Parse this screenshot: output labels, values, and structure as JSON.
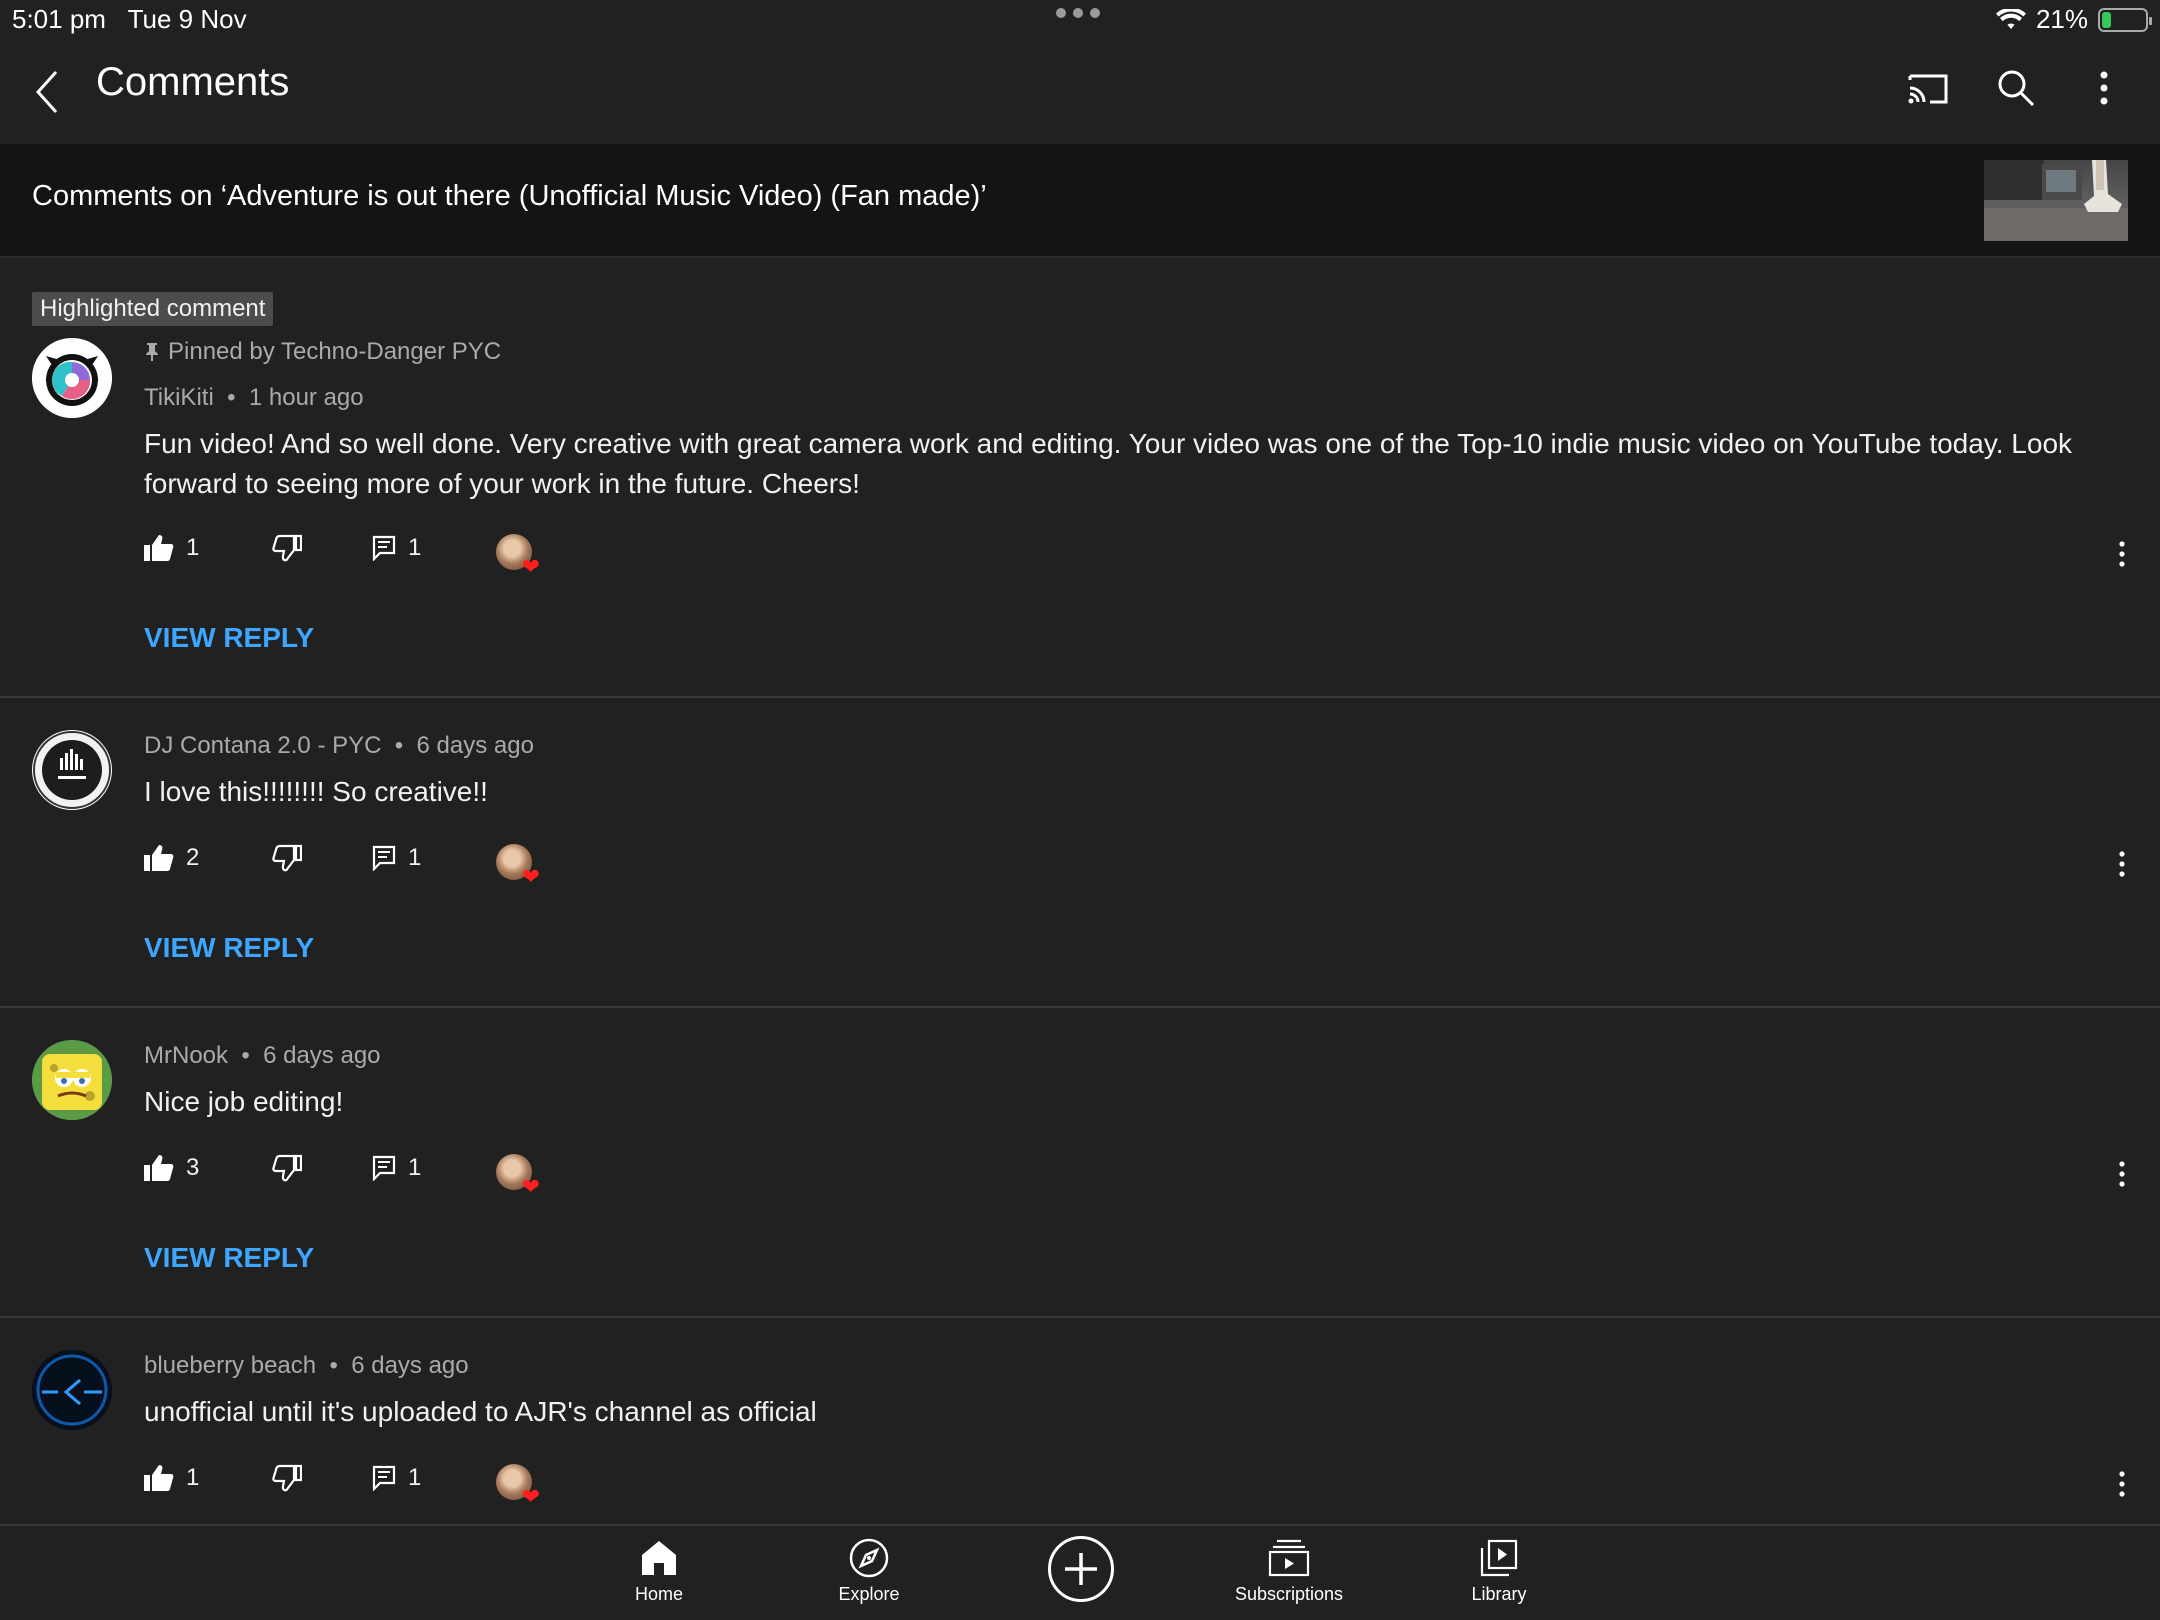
{
  "status_bar": {
    "time": "5:01 pm",
    "date": "Tue 9 Nov",
    "battery": "21%",
    "battery_level": 0.21
  },
  "app_bar": {
    "title": "Comments",
    "icons": [
      "back-arrow-icon",
      "cast-icon",
      "search-icon",
      "more-vert-icon"
    ]
  },
  "video": {
    "title": "Comments on ‘Adventure is out there (Unofficial Music Video) (Fan made)’"
  },
  "comments": [
    {
      "badge": "Highlighted comment",
      "pinned": "Pinned by Techno-Danger PYC",
      "author": "TikiKiti",
      "time": "1 hour ago",
      "text": "Fun video! And so well done. Very creative with great camera work and editing. Your video was one of the Top-10 indie music video on YouTube today.  Look forward to seeing more of your work in the future. Cheers!",
      "likes": "1",
      "replies": "1",
      "view_reply": "VIEW REPLY"
    },
    {
      "author": "DJ Contana 2.0 - PYC",
      "time": "6 days ago",
      "text": "I love this!!!!!!!! So creative!!",
      "likes": "2",
      "replies": "1",
      "view_reply": "VIEW REPLY"
    },
    {
      "author": "MrNook",
      "time": "6 days ago",
      "text": "Nice job editing!",
      "likes": "3",
      "replies": "1",
      "view_reply": "VIEW REPLY"
    },
    {
      "author": "blueberry beach",
      "time": "6 days ago",
      "text": "unofficial until it's uploaded to AJR's channel as official",
      "likes": "1",
      "replies": "1"
    }
  ],
  "bottom_nav": [
    {
      "label": "Home",
      "icon": "home-icon"
    },
    {
      "label": "Explore",
      "icon": "compass-icon"
    },
    {
      "label": "",
      "icon": "add-icon"
    },
    {
      "label": "Subscriptions",
      "icon": "subscriptions-icon"
    },
    {
      "label": "Library",
      "icon": "library-icon"
    }
  ],
  "colors": {
    "background": "#212121",
    "link": "#3ea6ff",
    "heart": "#ff1f1f",
    "secondary_text": "#aaaaaa"
  }
}
